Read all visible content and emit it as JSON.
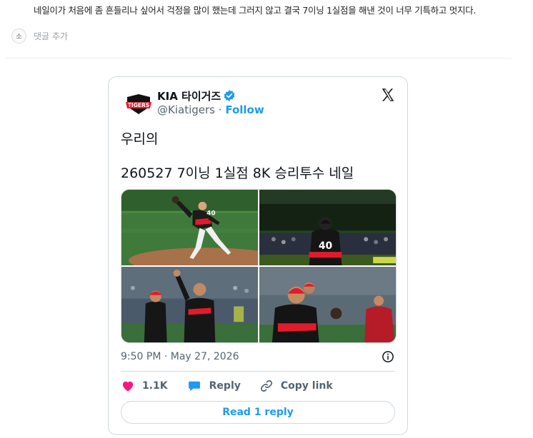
{
  "comment": {
    "text": "네일이가 처음에 좀 흔들리나 싶어서 걱정을 많이 했는데 그러지 않고 결국 7이닝 1실점을 해낸 것이 너무 기특하고 멋지다.",
    "avatar_initial": "소",
    "reply_placeholder": "댓글 추가"
  },
  "tweet": {
    "account_name": "KIA 타이거즈",
    "handle": "@Kiatigers",
    "follow_label": "Follow",
    "logo_text": "TIGERS",
    "text_line1": "우리의",
    "text_line2": "260527 7이닝 1실점 8K 승리투수 네일",
    "photos": [
      {
        "jersey_number": "40",
        "alt": "pitcher-delivery"
      },
      {
        "jersey_number": "40",
        "alt": "pitcher-back"
      },
      {
        "jersey_number": "",
        "alt": "team-celebration"
      },
      {
        "jersey_number": "",
        "alt": "handshake-line"
      }
    ],
    "timestamp": "9:50 PM · May 27, 2026",
    "likes": "1.1K",
    "reply_label": "Reply",
    "copy_link_label": "Copy link",
    "read_replies_label": "Read 1 reply"
  },
  "colors": {
    "accent": "#1d9bf0",
    "like": "#f91880",
    "tigers_red": "#e21b2c"
  }
}
